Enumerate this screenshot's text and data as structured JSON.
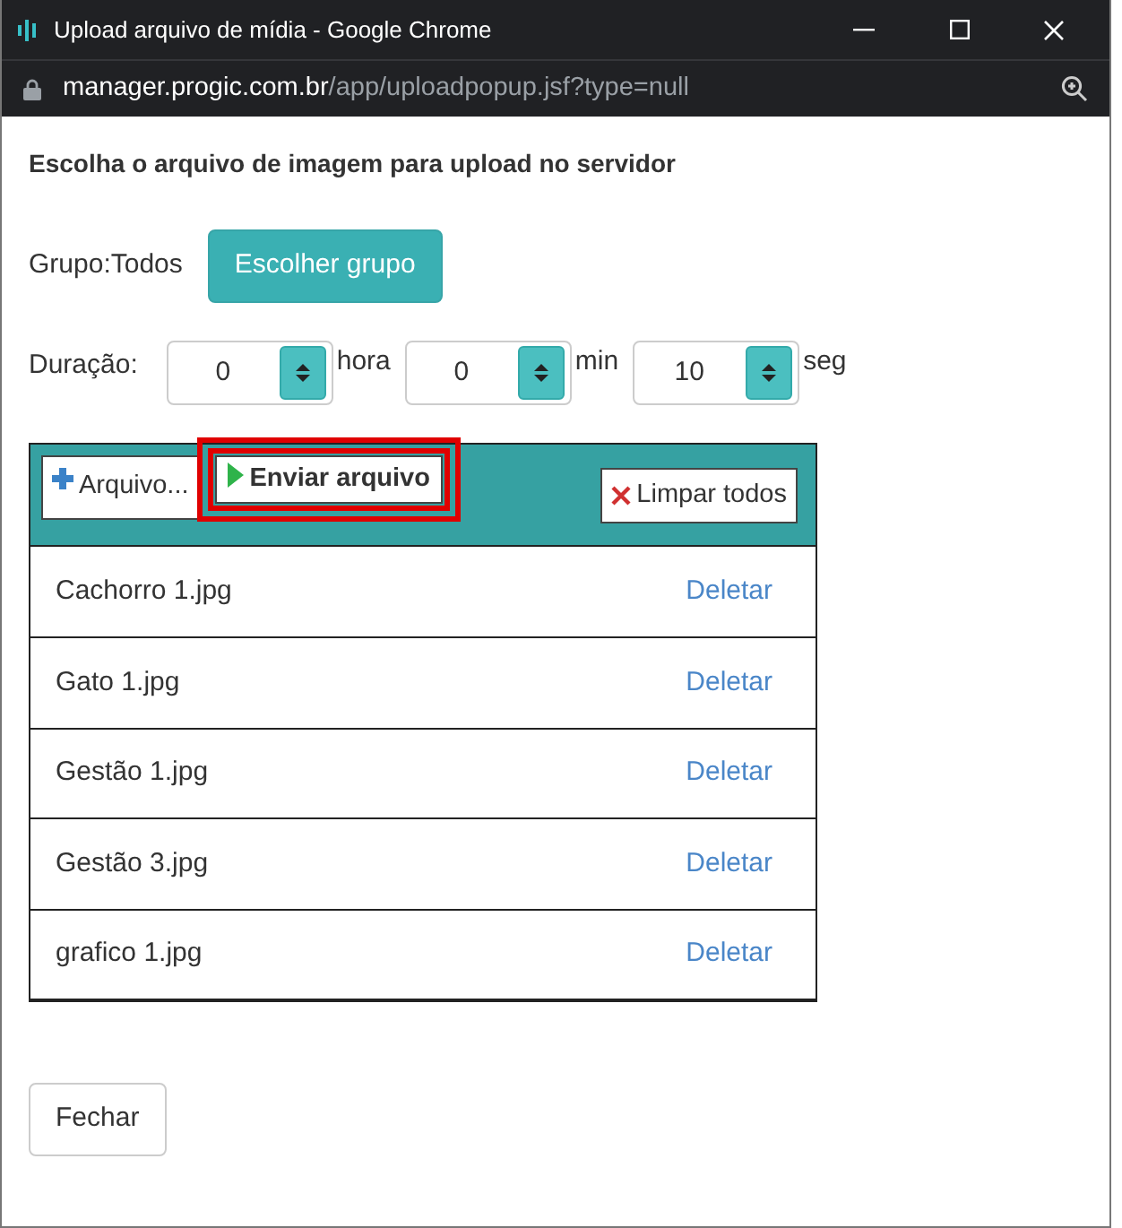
{
  "window": {
    "title": "Upload arquivo de mídia - Google Chrome",
    "url_host": "manager.progic.com.br",
    "url_path": "/app/uploadpopup.jsf?type=null"
  },
  "heading": "Escolha o arquivo de imagem para upload no servidor",
  "group": {
    "label": "Grupo:Todos",
    "button": "Escolher grupo"
  },
  "duration": {
    "label": "Duração:",
    "fields": [
      {
        "value": "0",
        "unit": "hora"
      },
      {
        "value": "0",
        "unit": "min"
      },
      {
        "value": "10",
        "unit": "seg"
      }
    ]
  },
  "toolbar": [
    {
      "kind": "add",
      "label": "Arquivo...",
      "highlighted": false
    },
    {
      "kind": "upload",
      "label": "Enviar arquivo",
      "highlighted": true
    },
    {
      "kind": "clear",
      "label": "Limpar todos",
      "highlighted": false
    }
  ],
  "files": [
    {
      "name": "Cachorro 1.jpg",
      "action": "Deletar"
    },
    {
      "name": "Gato 1.jpg",
      "action": "Deletar"
    },
    {
      "name": "Gestão 1.jpg",
      "action": "Deletar"
    },
    {
      "name": "Gestão 3.jpg",
      "action": "Deletar"
    },
    {
      "name": "grafico 1.jpg",
      "action": "Deletar"
    }
  ],
  "close_button": "Fechar"
}
